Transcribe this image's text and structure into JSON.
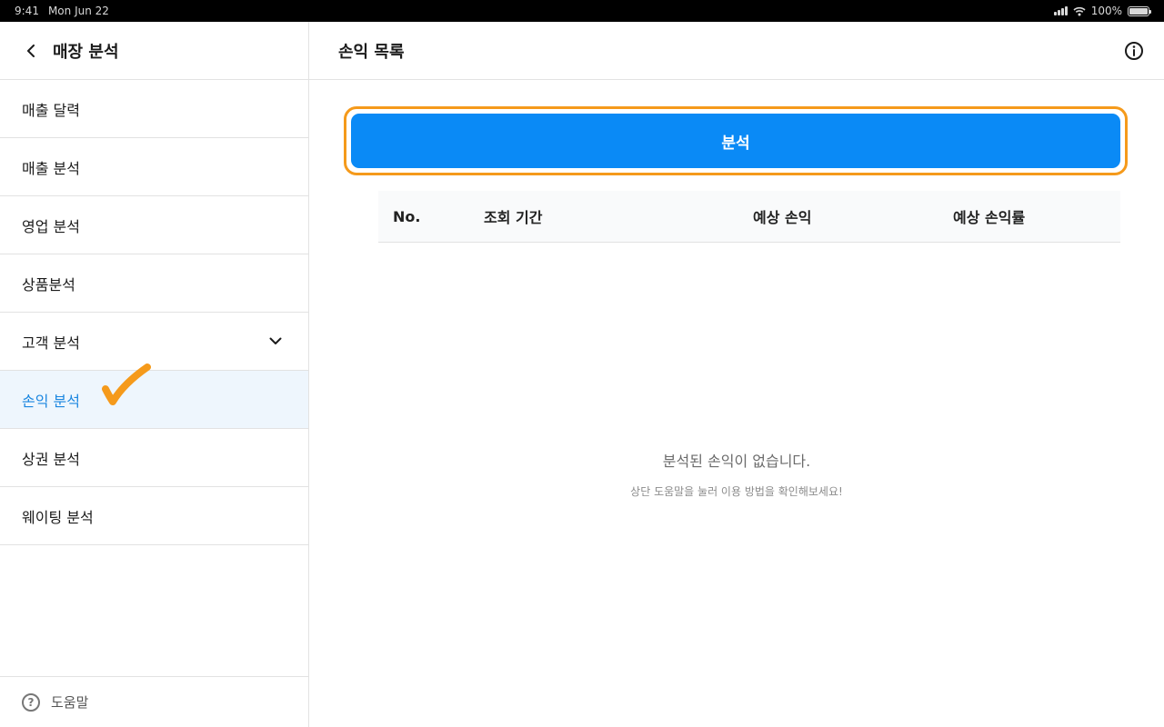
{
  "status_bar": {
    "time": "9:41",
    "date": "Mon Jun 22",
    "battery": "100%"
  },
  "sidebar": {
    "title": "매장 분석",
    "items": [
      {
        "label": "매출 달력"
      },
      {
        "label": "매출 분석"
      },
      {
        "label": "영업 분석"
      },
      {
        "label": "상품분석"
      },
      {
        "label": "고객 분석",
        "expandable": true
      },
      {
        "label": "손익 분석",
        "active": true
      },
      {
        "label": "상권 분석"
      },
      {
        "label": "웨이팅 분석"
      }
    ],
    "footer": {
      "help_label": "도움말"
    }
  },
  "main": {
    "title": "손익 목록",
    "analyze_button": "분석",
    "table": {
      "columns": [
        "No.",
        "조회 기간",
        "예상 손익",
        "예상 손익률"
      ]
    },
    "empty_state": {
      "title": "분석된 손익이 없습니다.",
      "subtitle": "상단 도움말을 눌러 이용 방법을 확인해보세요!"
    }
  },
  "colors": {
    "accent": "#0a8af6",
    "highlight": "#f59a1b",
    "active_text": "#1a86e0",
    "active_bg": "#eef6fd"
  },
  "icons": [
    "back-chevron-icon",
    "chevron-down-icon",
    "checkmark-icon",
    "help-icon",
    "info-icon",
    "signal-icon",
    "wifi-icon",
    "battery-icon"
  ]
}
